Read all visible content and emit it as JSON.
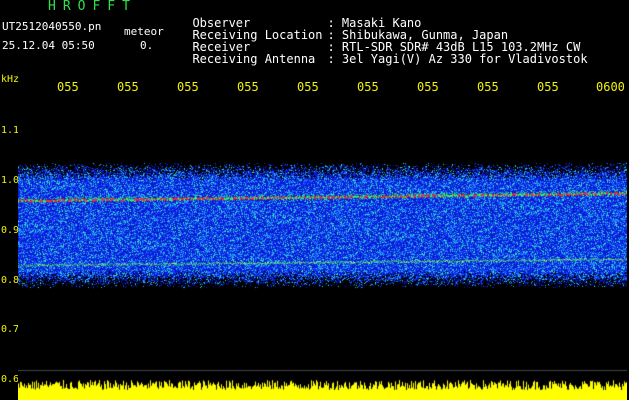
{
  "header": {
    "app_title": "HROFFT",
    "file_name": "UT2512040550.pn",
    "meteor_label": "meteor",
    "datetime": "25.12.04 05:50",
    "count": "0.",
    "info": [
      {
        "key": "Observer",
        "value": ": Masaki Kano"
      },
      {
        "key": "Receiving Location",
        "value": ": Shibukawa, Gunma, Japan"
      },
      {
        "key": "Receiver",
        "value": ": RTL-SDR SDR# 43dB L15 103.2MHz CW"
      },
      {
        "key": "Receiving Antenna",
        "value": ": 3el Yagi(V) Az 330 for Vladivostok"
      }
    ]
  },
  "axis": {
    "unit": "kHz",
    "time_ticks": [
      "055",
      "055",
      "055",
      "055",
      "055",
      "055",
      "055",
      "055",
      "055",
      "0600"
    ],
    "freq_labels": [
      "1.1",
      "1.0",
      "0.9",
      "0.8",
      "0.7",
      "0.6"
    ]
  },
  "colors": {
    "background": "#000000",
    "text_green": "#2fe04a",
    "text_yellow": "#f2f20a",
    "noise_blue": "#1a3cff",
    "noise_cyan": "#2ad4e8",
    "trace_red": "#ff3020",
    "power_yellow": "#ffff00"
  }
}
